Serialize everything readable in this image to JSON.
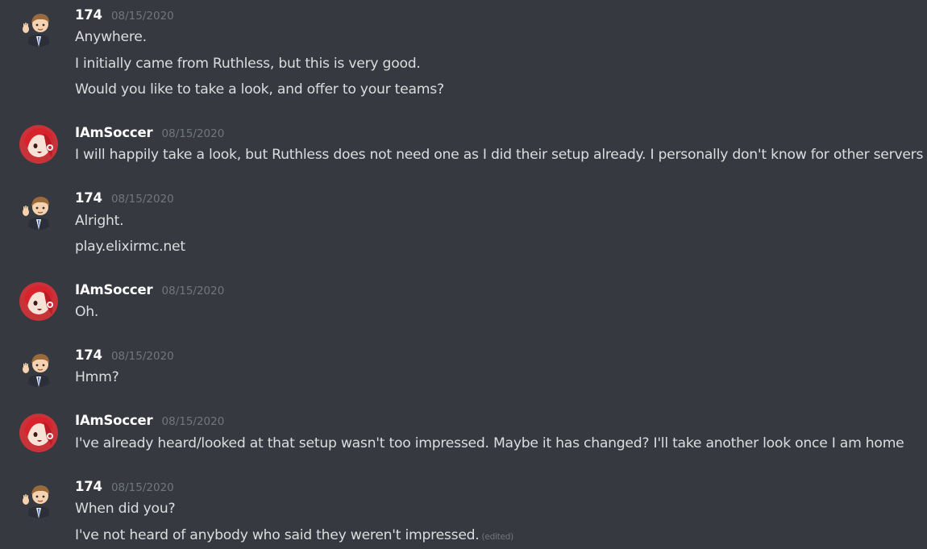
{
  "messages": [
    {
      "author": "174",
      "timestamp": "08/15/2020",
      "avatar_icon": "boy-waving-avatar-icon",
      "lines": [
        "Anywhere.",
        "I initially came from Ruthless, but this is very good.",
        "Would you like to take a look, and offer to your teams?"
      ]
    },
    {
      "author": "IAmSoccer",
      "timestamp": "08/15/2020",
      "avatar_icon": "red-hair-anime-avatar-icon",
      "lines": [
        "I will happily take a look, but Ruthless does not need one as I did their setup already. I personally don't know for other servers"
      ]
    },
    {
      "author": "174",
      "timestamp": "08/15/2020",
      "avatar_icon": "boy-waving-avatar-icon",
      "lines": [
        "Alright.",
        "play.elixirmc.net"
      ]
    },
    {
      "author": "IAmSoccer",
      "timestamp": "08/15/2020",
      "avatar_icon": "red-hair-anime-avatar-icon",
      "lines": [
        "Oh."
      ]
    },
    {
      "author": "174",
      "timestamp": "08/15/2020",
      "avatar_icon": "boy-waving-avatar-icon",
      "lines": [
        "Hmm?"
      ]
    },
    {
      "author": "IAmSoccer",
      "timestamp": "08/15/2020",
      "avatar_icon": "red-hair-anime-avatar-icon",
      "lines": [
        "I've already heard/looked at that setup wasn't too impressed. Maybe it has changed? I'll take another look once I am home"
      ]
    },
    {
      "author": "174",
      "timestamp": "08/15/2020",
      "avatar_icon": "boy-waving-avatar-icon",
      "lines": [
        "When did you?",
        "I've not heard of anybody who said they weren't impressed."
      ],
      "edited_label": "(edited)"
    }
  ],
  "colors": {
    "background": "#36393f",
    "username": "#ffffff",
    "message_text": "#dcddde",
    "timestamp": "#72767d"
  }
}
